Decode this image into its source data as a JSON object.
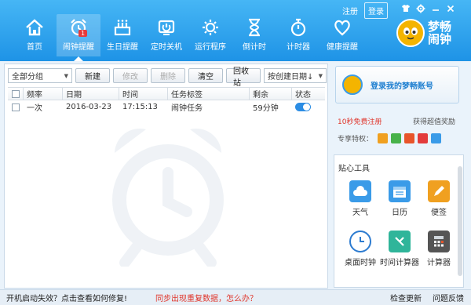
{
  "header": {
    "nav": [
      {
        "label": "首页",
        "icon": "home-icon"
      },
      {
        "label": "闹钟提醒",
        "icon": "alarm-clock-icon",
        "badge": "1",
        "active": true
      },
      {
        "label": "生日提醒",
        "icon": "birthday-cake-icon"
      },
      {
        "label": "定时关机",
        "icon": "power-off-icon"
      },
      {
        "label": "运行程序",
        "icon": "run-program-icon"
      },
      {
        "label": "倒计时",
        "icon": "hourglass-icon"
      },
      {
        "label": "计时器",
        "icon": "stopwatch-icon"
      },
      {
        "label": "健康提醒",
        "icon": "heart-icon"
      }
    ],
    "register": "注册",
    "login": "登录",
    "logo_text": "梦畅闹钟"
  },
  "toolbar": {
    "group_select": "全部分组",
    "new": "新建",
    "edit": "修改",
    "delete": "删除",
    "clear": "清空",
    "recycle": "回收站",
    "sort_select": "按创建日期↓"
  },
  "table": {
    "columns": [
      "频率",
      "日期",
      "时间",
      "任务标签",
      "剩余",
      "状态"
    ],
    "rows": [
      {
        "freq": "一次",
        "date": "2016-03-23",
        "time": "17:15:13",
        "label": "闹钟任务",
        "remaining": "59分钟",
        "status": "on"
      }
    ]
  },
  "side": {
    "login_prompt": "登录我的梦畅账号",
    "reg_free": "10秒免费注册",
    "reg_reward": "获得超值奖励",
    "privilege": "专享特权：",
    "tools_title": "贴心工具",
    "tools": [
      {
        "label": "天气",
        "icon": "weather-icon",
        "color": "#3a9be8"
      },
      {
        "label": "日历",
        "icon": "calendar-icon",
        "color": "#3a9be8"
      },
      {
        "label": "便签",
        "icon": "note-icon",
        "color": "#f0a020"
      },
      {
        "label": "桌面时钟",
        "icon": "desktop-clock-icon",
        "color": "#2c7bd0"
      },
      {
        "label": "时间计算器",
        "icon": "time-calculator-icon",
        "color": "#2fb59a"
      },
      {
        "label": "计算器",
        "icon": "calculator-icon",
        "color": "#555555"
      }
    ]
  },
  "status": {
    "startup_fail": "开机启动失效？点击查看如何修复!",
    "sync_issue": "同步出现重复数据，怎么办？",
    "check_update": "检查更新",
    "feedback": "问题反馈"
  }
}
